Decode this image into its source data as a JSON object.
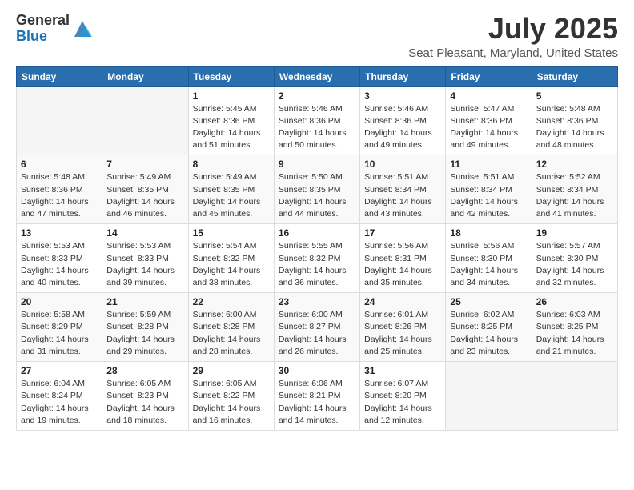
{
  "logo": {
    "general": "General",
    "blue": "Blue"
  },
  "title": "July 2025",
  "subtitle": "Seat Pleasant, Maryland, United States",
  "weekdays": [
    "Sunday",
    "Monday",
    "Tuesday",
    "Wednesday",
    "Thursday",
    "Friday",
    "Saturday"
  ],
  "weeks": [
    [
      {
        "day": "",
        "info": ""
      },
      {
        "day": "",
        "info": ""
      },
      {
        "day": "1",
        "info": "Sunrise: 5:45 AM\nSunset: 8:36 PM\nDaylight: 14 hours\nand 51 minutes."
      },
      {
        "day": "2",
        "info": "Sunrise: 5:46 AM\nSunset: 8:36 PM\nDaylight: 14 hours\nand 50 minutes."
      },
      {
        "day": "3",
        "info": "Sunrise: 5:46 AM\nSunset: 8:36 PM\nDaylight: 14 hours\nand 49 minutes."
      },
      {
        "day": "4",
        "info": "Sunrise: 5:47 AM\nSunset: 8:36 PM\nDaylight: 14 hours\nand 49 minutes."
      },
      {
        "day": "5",
        "info": "Sunrise: 5:48 AM\nSunset: 8:36 PM\nDaylight: 14 hours\nand 48 minutes."
      }
    ],
    [
      {
        "day": "6",
        "info": "Sunrise: 5:48 AM\nSunset: 8:36 PM\nDaylight: 14 hours\nand 47 minutes."
      },
      {
        "day": "7",
        "info": "Sunrise: 5:49 AM\nSunset: 8:35 PM\nDaylight: 14 hours\nand 46 minutes."
      },
      {
        "day": "8",
        "info": "Sunrise: 5:49 AM\nSunset: 8:35 PM\nDaylight: 14 hours\nand 45 minutes."
      },
      {
        "day": "9",
        "info": "Sunrise: 5:50 AM\nSunset: 8:35 PM\nDaylight: 14 hours\nand 44 minutes."
      },
      {
        "day": "10",
        "info": "Sunrise: 5:51 AM\nSunset: 8:34 PM\nDaylight: 14 hours\nand 43 minutes."
      },
      {
        "day": "11",
        "info": "Sunrise: 5:51 AM\nSunset: 8:34 PM\nDaylight: 14 hours\nand 42 minutes."
      },
      {
        "day": "12",
        "info": "Sunrise: 5:52 AM\nSunset: 8:34 PM\nDaylight: 14 hours\nand 41 minutes."
      }
    ],
    [
      {
        "day": "13",
        "info": "Sunrise: 5:53 AM\nSunset: 8:33 PM\nDaylight: 14 hours\nand 40 minutes."
      },
      {
        "day": "14",
        "info": "Sunrise: 5:53 AM\nSunset: 8:33 PM\nDaylight: 14 hours\nand 39 minutes."
      },
      {
        "day": "15",
        "info": "Sunrise: 5:54 AM\nSunset: 8:32 PM\nDaylight: 14 hours\nand 38 minutes."
      },
      {
        "day": "16",
        "info": "Sunrise: 5:55 AM\nSunset: 8:32 PM\nDaylight: 14 hours\nand 36 minutes."
      },
      {
        "day": "17",
        "info": "Sunrise: 5:56 AM\nSunset: 8:31 PM\nDaylight: 14 hours\nand 35 minutes."
      },
      {
        "day": "18",
        "info": "Sunrise: 5:56 AM\nSunset: 8:30 PM\nDaylight: 14 hours\nand 34 minutes."
      },
      {
        "day": "19",
        "info": "Sunrise: 5:57 AM\nSunset: 8:30 PM\nDaylight: 14 hours\nand 32 minutes."
      }
    ],
    [
      {
        "day": "20",
        "info": "Sunrise: 5:58 AM\nSunset: 8:29 PM\nDaylight: 14 hours\nand 31 minutes."
      },
      {
        "day": "21",
        "info": "Sunrise: 5:59 AM\nSunset: 8:28 PM\nDaylight: 14 hours\nand 29 minutes."
      },
      {
        "day": "22",
        "info": "Sunrise: 6:00 AM\nSunset: 8:28 PM\nDaylight: 14 hours\nand 28 minutes."
      },
      {
        "day": "23",
        "info": "Sunrise: 6:00 AM\nSunset: 8:27 PM\nDaylight: 14 hours\nand 26 minutes."
      },
      {
        "day": "24",
        "info": "Sunrise: 6:01 AM\nSunset: 8:26 PM\nDaylight: 14 hours\nand 25 minutes."
      },
      {
        "day": "25",
        "info": "Sunrise: 6:02 AM\nSunset: 8:25 PM\nDaylight: 14 hours\nand 23 minutes."
      },
      {
        "day": "26",
        "info": "Sunrise: 6:03 AM\nSunset: 8:25 PM\nDaylight: 14 hours\nand 21 minutes."
      }
    ],
    [
      {
        "day": "27",
        "info": "Sunrise: 6:04 AM\nSunset: 8:24 PM\nDaylight: 14 hours\nand 19 minutes."
      },
      {
        "day": "28",
        "info": "Sunrise: 6:05 AM\nSunset: 8:23 PM\nDaylight: 14 hours\nand 18 minutes."
      },
      {
        "day": "29",
        "info": "Sunrise: 6:05 AM\nSunset: 8:22 PM\nDaylight: 14 hours\nand 16 minutes."
      },
      {
        "day": "30",
        "info": "Sunrise: 6:06 AM\nSunset: 8:21 PM\nDaylight: 14 hours\nand 14 minutes."
      },
      {
        "day": "31",
        "info": "Sunrise: 6:07 AM\nSunset: 8:20 PM\nDaylight: 14 hours\nand 12 minutes."
      },
      {
        "day": "",
        "info": ""
      },
      {
        "day": "",
        "info": ""
      }
    ]
  ]
}
